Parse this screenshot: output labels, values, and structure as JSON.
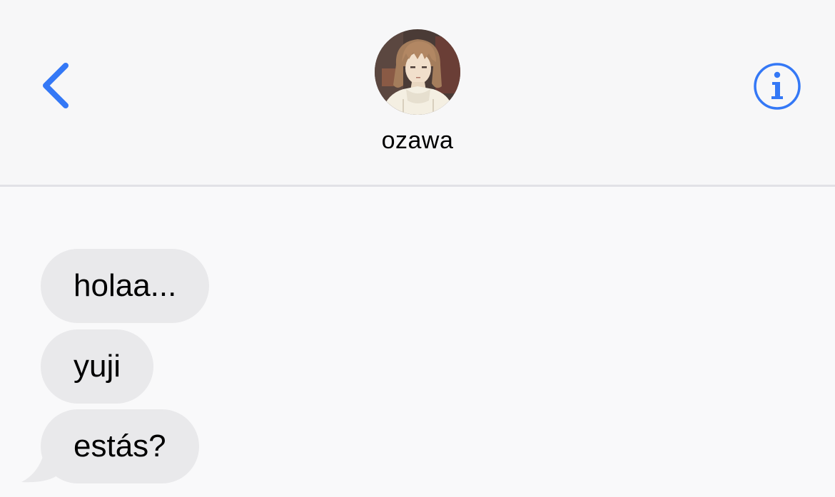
{
  "header": {
    "back_icon": "chevron-left-icon",
    "contact_name": "ozawa",
    "info_icon": "info-circle-icon",
    "accent_color": "#3478f6"
  },
  "messages": [
    {
      "direction": "incoming",
      "text": "holaa..."
    },
    {
      "direction": "incoming",
      "text": "yuji"
    },
    {
      "direction": "incoming",
      "text": "estás?"
    }
  ],
  "colors": {
    "header_bg": "#f7f7f8",
    "thread_bg": "#f9f9fa",
    "incoming_bubble": "#e9e9eb"
  }
}
